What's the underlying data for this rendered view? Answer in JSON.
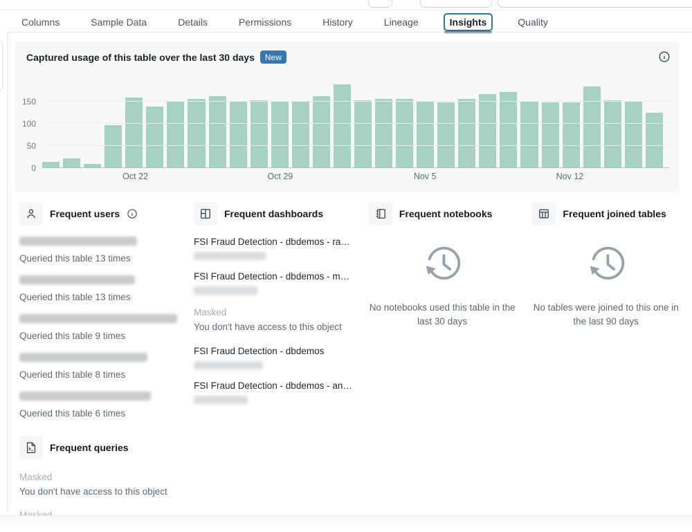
{
  "tabs": [
    {
      "label": "Columns",
      "selected": false
    },
    {
      "label": "Sample Data",
      "selected": false
    },
    {
      "label": "Details",
      "selected": false
    },
    {
      "label": "Permissions",
      "selected": false
    },
    {
      "label": "History",
      "selected": false
    },
    {
      "label": "Lineage",
      "selected": false
    },
    {
      "label": "Insights",
      "selected": true
    },
    {
      "label": "Quality",
      "selected": false
    }
  ],
  "usage": {
    "title": "Captured usage of this table over the last 30 days",
    "badge": "New"
  },
  "chart_data": {
    "type": "bar",
    "title": "Captured usage of this table over the last 30 days",
    "categories": [
      "",
      "",
      "",
      "",
      "Oct 22",
      "",
      "",
      "",
      "",
      "",
      "",
      "Oct 29",
      "",
      "",
      "",
      "",
      "",
      "",
      "Nov 5",
      "",
      "",
      "",
      "",
      "",
      "",
      "Nov 12",
      "",
      "",
      "",
      ""
    ],
    "values": [
      12,
      20,
      8,
      95,
      157,
      137,
      148,
      155,
      160,
      149,
      152,
      149,
      149,
      160,
      187,
      152,
      154,
      154,
      148,
      147,
      154,
      166,
      170,
      148,
      147,
      147,
      183,
      152,
      148,
      124
    ],
    "xlabel": "",
    "ylabel": "",
    "yticks": [
      0,
      50,
      100,
      150
    ],
    "ylim": [
      0,
      195
    ],
    "bar_color": "#a7d1c3",
    "grid": "horizontal",
    "legend": "none"
  },
  "sections": {
    "users": {
      "title": "Frequent users",
      "items": [
        {
          "name_masked": true,
          "blur_width": 170,
          "caption": "Queried this table 13 times"
        },
        {
          "name_masked": true,
          "blur_width": 167,
          "caption": "Queried this table 13 times"
        },
        {
          "name_masked": true,
          "blur_width": 228,
          "caption": "Queried this table 9 times"
        },
        {
          "name_masked": true,
          "blur_width": 185,
          "caption": "Queried this table 8 times"
        },
        {
          "name_masked": true,
          "blur_width": 190,
          "caption": "Queried this table 6 times"
        }
      ]
    },
    "dashboards": {
      "title": "Frequent dashboards",
      "items": [
        {
          "title": "FSI Fraud Detection - dbdemos - ra…",
          "subtitle_masked": true,
          "blur_width": 104
        },
        {
          "title": "FSI Fraud Detection - dbdemos - m…",
          "subtitle_masked": true,
          "blur_width": 92
        },
        {
          "masked": true,
          "masked_label": "Masked",
          "masked_caption": "You don't have access to this object"
        },
        {
          "title": "FSI Fraud Detection - dbdemos",
          "subtitle_masked": true,
          "blur_width": 100
        },
        {
          "title": "FSI Fraud Detection - dbdemos - an…",
          "subtitle_masked": true,
          "blur_width": 78
        }
      ]
    },
    "notebooks": {
      "title": "Frequent notebooks",
      "empty_text": "No notebooks used this table in the last 30 days"
    },
    "joined_tables": {
      "title": "Frequent joined tables",
      "empty_text": "No tables were joined to this one in the last 90 days"
    },
    "queries": {
      "title": "Frequent queries",
      "items": [
        {
          "masked_label": "Masked",
          "masked_caption": "You don't have access to this object"
        },
        {
          "masked_label": "Masked",
          "masked_caption": ""
        }
      ]
    }
  }
}
